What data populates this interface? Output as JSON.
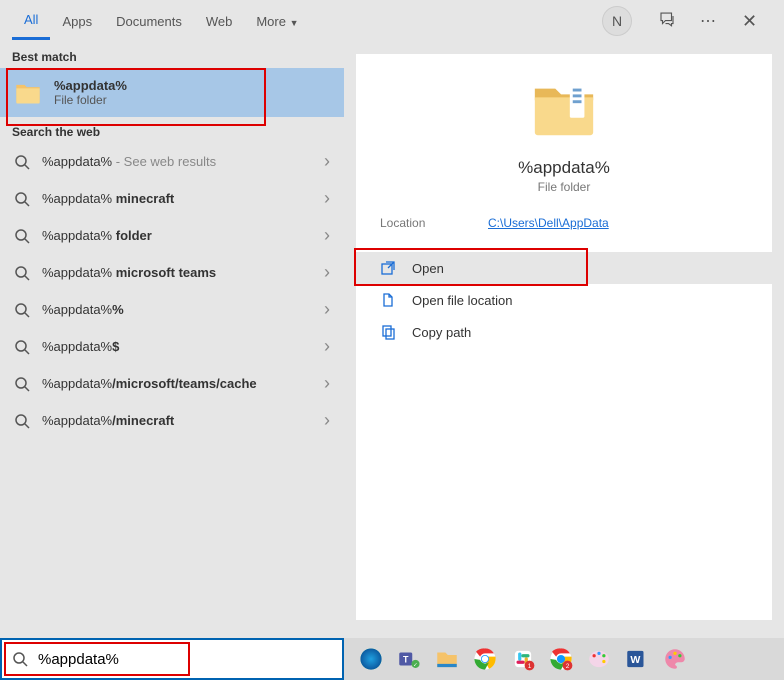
{
  "tabs": {
    "items": [
      "All",
      "Apps",
      "Documents",
      "Web",
      "More"
    ],
    "active": "All"
  },
  "avatar": "N",
  "sections": {
    "best_match": "Best match",
    "search_web": "Search the web"
  },
  "best_match": {
    "title": "%appdata%",
    "subtitle": "File folder"
  },
  "web_results": [
    {
      "text": "%appdata%",
      "suffix": " - See web results",
      "bold": false
    },
    {
      "prefix": "%appdata% ",
      "bold_part": "minecraft"
    },
    {
      "prefix": "%appdata% ",
      "bold_part": "folder"
    },
    {
      "prefix": "%appdata% ",
      "bold_part": "microsoft teams"
    },
    {
      "prefix": "%appdata%",
      "bold_part": "%"
    },
    {
      "prefix": "%appdata%",
      "bold_part": "$"
    },
    {
      "prefix": "%appdata%",
      "bold_part": "/microsoft/teams/cache"
    },
    {
      "prefix": "%appdata%",
      "bold_part": "/minecraft"
    }
  ],
  "preview": {
    "title": "%appdata%",
    "subtitle": "File folder",
    "location_label": "Location",
    "location_value": "C:\\Users\\Dell\\AppData",
    "actions": [
      "Open",
      "Open file location",
      "Copy path"
    ]
  },
  "search_input": "%appdata%"
}
